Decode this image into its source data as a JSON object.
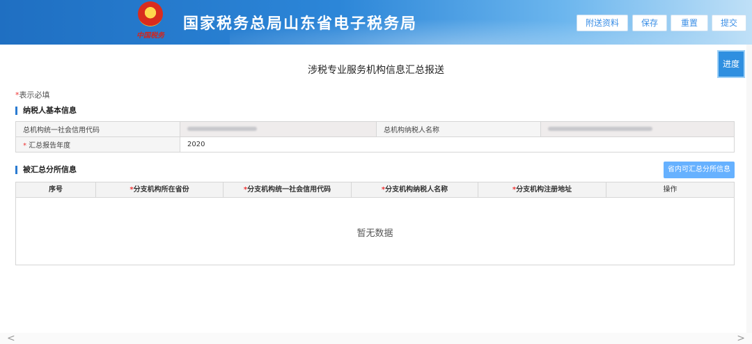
{
  "header": {
    "emblem_caption": "中国税务",
    "title": "国家税务总局山东省电子税务局",
    "buttons": {
      "attach": "附送资料",
      "save": "保存",
      "reset": "重置",
      "submit": "提交"
    }
  },
  "progress_label": "进度",
  "page_title": "涉税专业服务机构信息汇总报送",
  "required_note": {
    "star": "*",
    "text": "表示必填"
  },
  "taxpayer_section": {
    "title": "纳税人基本信息",
    "rows": [
      {
        "label1": "总机构统一社会信用代码",
        "value1": "",
        "label2": "总机构纳税人名称",
        "value2": ""
      },
      {
        "star": "*",
        "label1": " 汇总报告年度",
        "value1": "2020"
      }
    ]
  },
  "branch_section": {
    "title": "被汇总分所信息",
    "summary_button": "省内可汇总分所信息",
    "columns": [
      {
        "star": "",
        "label": "序号"
      },
      {
        "star": "*",
        "label": "分支机构所在省份"
      },
      {
        "star": "*",
        "label": "分支机构统一社会信用代码"
      },
      {
        "star": "*",
        "label": "分支机构纳税人名称"
      },
      {
        "star": "*",
        "label": "分支机构注册地址"
      },
      {
        "star": "",
        "label": "操作"
      }
    ],
    "empty_text": "暂无数据"
  },
  "scroll": {
    "left_arrow": "<",
    "right_arrow": ">"
  }
}
